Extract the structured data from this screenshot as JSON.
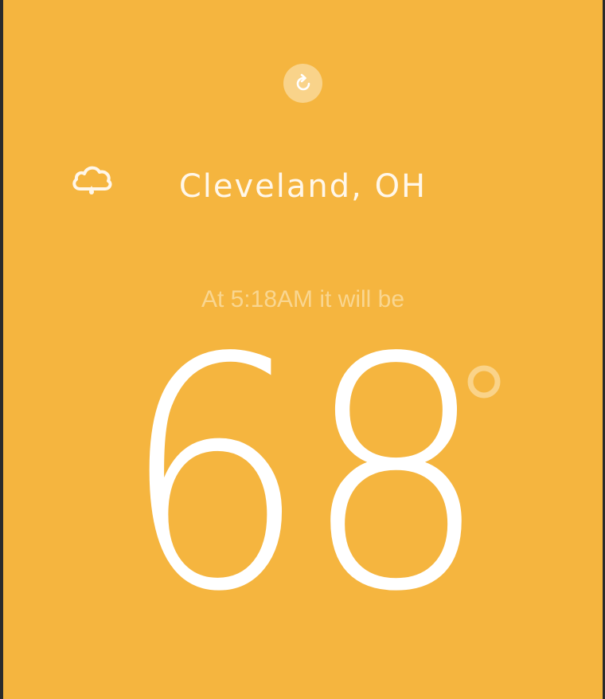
{
  "app": {
    "background_color": "#f5b53f"
  },
  "header": {
    "refresh_icon": "refresh-icon"
  },
  "location": {
    "weather_icon": "cloud-rain-icon",
    "city": "Cleveland, OH"
  },
  "forecast": {
    "subtitle": "At 5:18AM it will be",
    "temperature": "68",
    "unit_icon": "degree-icon"
  }
}
